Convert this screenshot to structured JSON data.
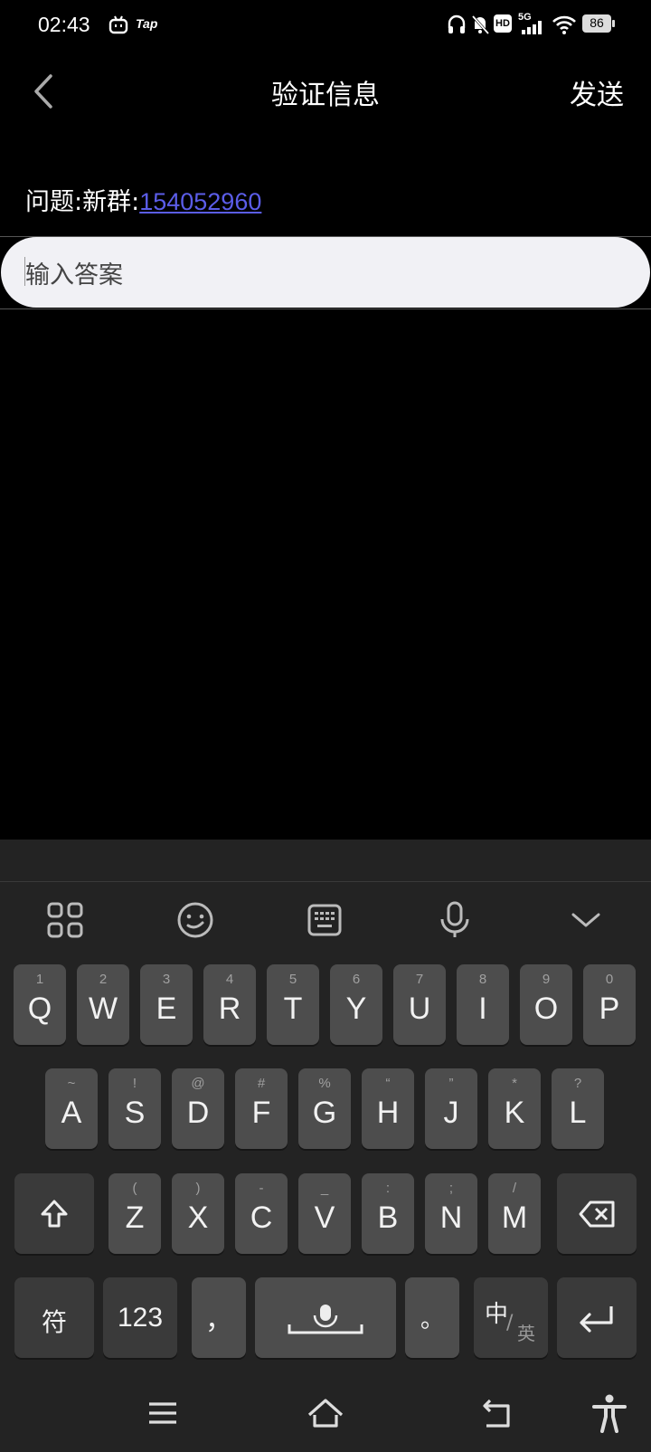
{
  "status_bar": {
    "time": "02:43",
    "network": "5G",
    "battery": "86",
    "icons": [
      "bilibili-icon",
      "tap-icon",
      "headphones-icon",
      "mute-icon",
      "hd-icon",
      "signal-icon",
      "wifi-icon",
      "battery-icon"
    ],
    "tap_label": "Tap",
    "hd_label": "HD"
  },
  "header": {
    "title": "验证信息",
    "send_label": "发送"
  },
  "question": {
    "prefix": "问题:新群:",
    "link": "154052960"
  },
  "answer": {
    "placeholder": "输入答案",
    "value": ""
  },
  "keyboard": {
    "row1": [
      {
        "k": "Q",
        "h": "1"
      },
      {
        "k": "W",
        "h": "2"
      },
      {
        "k": "E",
        "h": "3"
      },
      {
        "k": "R",
        "h": "4"
      },
      {
        "k": "T",
        "h": "5"
      },
      {
        "k": "Y",
        "h": "6"
      },
      {
        "k": "U",
        "h": "7"
      },
      {
        "k": "I",
        "h": "8"
      },
      {
        "k": "O",
        "h": "9"
      },
      {
        "k": "P",
        "h": "0"
      }
    ],
    "row2": [
      {
        "k": "A",
        "h": "~"
      },
      {
        "k": "S",
        "h": "!"
      },
      {
        "k": "D",
        "h": "@"
      },
      {
        "k": "F",
        "h": "#"
      },
      {
        "k": "G",
        "h": "%"
      },
      {
        "k": "H",
        "h": "“"
      },
      {
        "k": "J",
        "h": "”"
      },
      {
        "k": "K",
        "h": "*"
      },
      {
        "k": "L",
        "h": "?"
      }
    ],
    "row3": [
      {
        "k": "Z",
        "h": "("
      },
      {
        "k": "X",
        "h": ")"
      },
      {
        "k": "C",
        "h": "-"
      },
      {
        "k": "V",
        "h": "_"
      },
      {
        "k": "B",
        "h": ":"
      },
      {
        "k": "N",
        "h": ";"
      },
      {
        "k": "M",
        "h": "/"
      }
    ],
    "symbols_label": "符",
    "numbers_label": "123",
    "comma_label": "，",
    "period_label": "。",
    "lang_main": "中",
    "lang_sub": "英"
  },
  "colors": {
    "link": "#5b5de8",
    "key": "#4d4d4d",
    "key_dark": "#3a3a3a",
    "keyboard_bg": "#232323"
  }
}
